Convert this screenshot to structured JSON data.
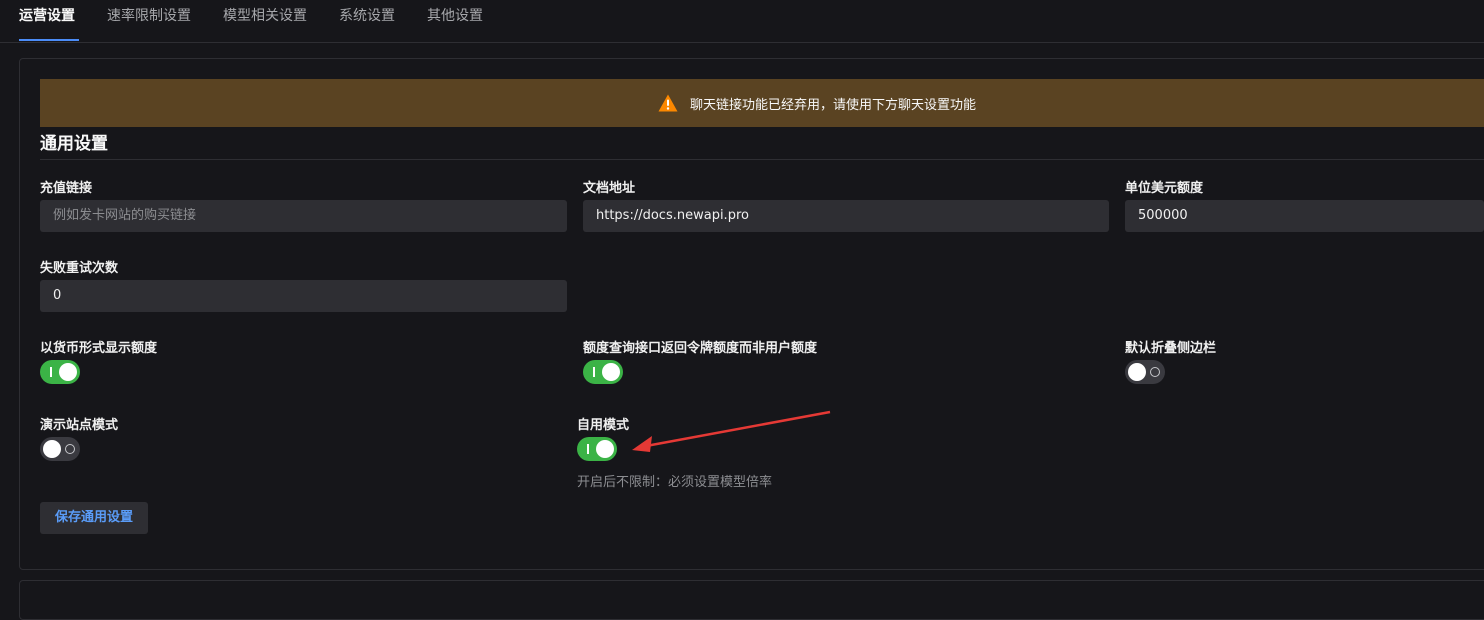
{
  "tabs": [
    {
      "label": "运营设置",
      "active": true
    },
    {
      "label": "速率限制设置",
      "active": false
    },
    {
      "label": "模型相关设置",
      "active": false
    },
    {
      "label": "系统设置",
      "active": false
    },
    {
      "label": "其他设置",
      "active": false
    }
  ],
  "banner": {
    "icon": "warning-icon",
    "text": "聊天链接功能已经弃用，请使用下方聊天设置功能",
    "color": "#5a4322"
  },
  "section": {
    "title": "通用设置"
  },
  "fields": {
    "topup_link": {
      "label": "充值链接",
      "value": "",
      "placeholder": "例如发卡网站的购买链接"
    },
    "docs_url": {
      "label": "文档地址",
      "value": "https://docs.newapi.pro"
    },
    "quota_per_unit": {
      "label": "单位美元额度",
      "value": "500000"
    },
    "retry_times": {
      "label": "失败重试次数",
      "value": "0"
    }
  },
  "toggles": {
    "display_in_currency": {
      "label": "以货币形式显示额度",
      "on": true
    },
    "display_token_stat": {
      "label": "额度查询接口返回令牌额度而非用户额度",
      "on": true
    },
    "default_collapse_sidebar": {
      "label": "默认折叠侧边栏",
      "on": false
    },
    "demo_site_mode": {
      "label": "演示站点模式",
      "on": false
    },
    "self_use_mode": {
      "label": "自用模式",
      "on": true,
      "hint": "开启后不限制：必须设置模型倍率"
    }
  },
  "save_button": {
    "label": "保存通用设置"
  },
  "colors": {
    "accent": "#4b8cf7",
    "toggle_on": "#3bb346",
    "annotation_arrow": "#e53935"
  }
}
